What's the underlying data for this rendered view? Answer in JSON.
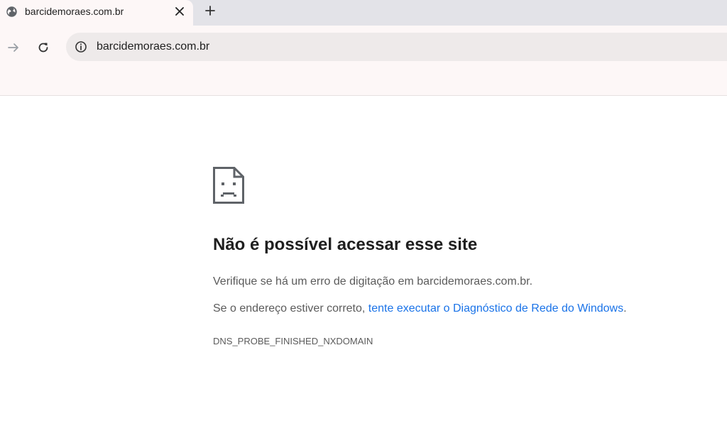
{
  "tab": {
    "title": "barcidemoraes.com.br",
    "favicon": "globe-icon",
    "close_icon": "close-icon",
    "new_tab_icon": "plus-icon"
  },
  "toolbar": {
    "forward_icon": "arrow-right-icon",
    "reload_icon": "reload-icon",
    "info_icon": "info-icon",
    "url": "barcidemoraes.com.br"
  },
  "error": {
    "icon": "sad-page-icon",
    "title": "Não é possível acessar esse site",
    "line1": "Verifique se há um erro de digitação em barcidemoraes.com.br.",
    "line2_prefix": "Se o endereço estiver correto, ",
    "line2_link": "tente executar o Diagnóstico de Rede do Windows",
    "line2_suffix": ".",
    "code": "DNS_PROBE_FINISHED_NXDOMAIN"
  },
  "colors": {
    "link": "#1a73e8",
    "text_secondary": "#5b5b5b",
    "text_primary": "#1f1f1f"
  }
}
